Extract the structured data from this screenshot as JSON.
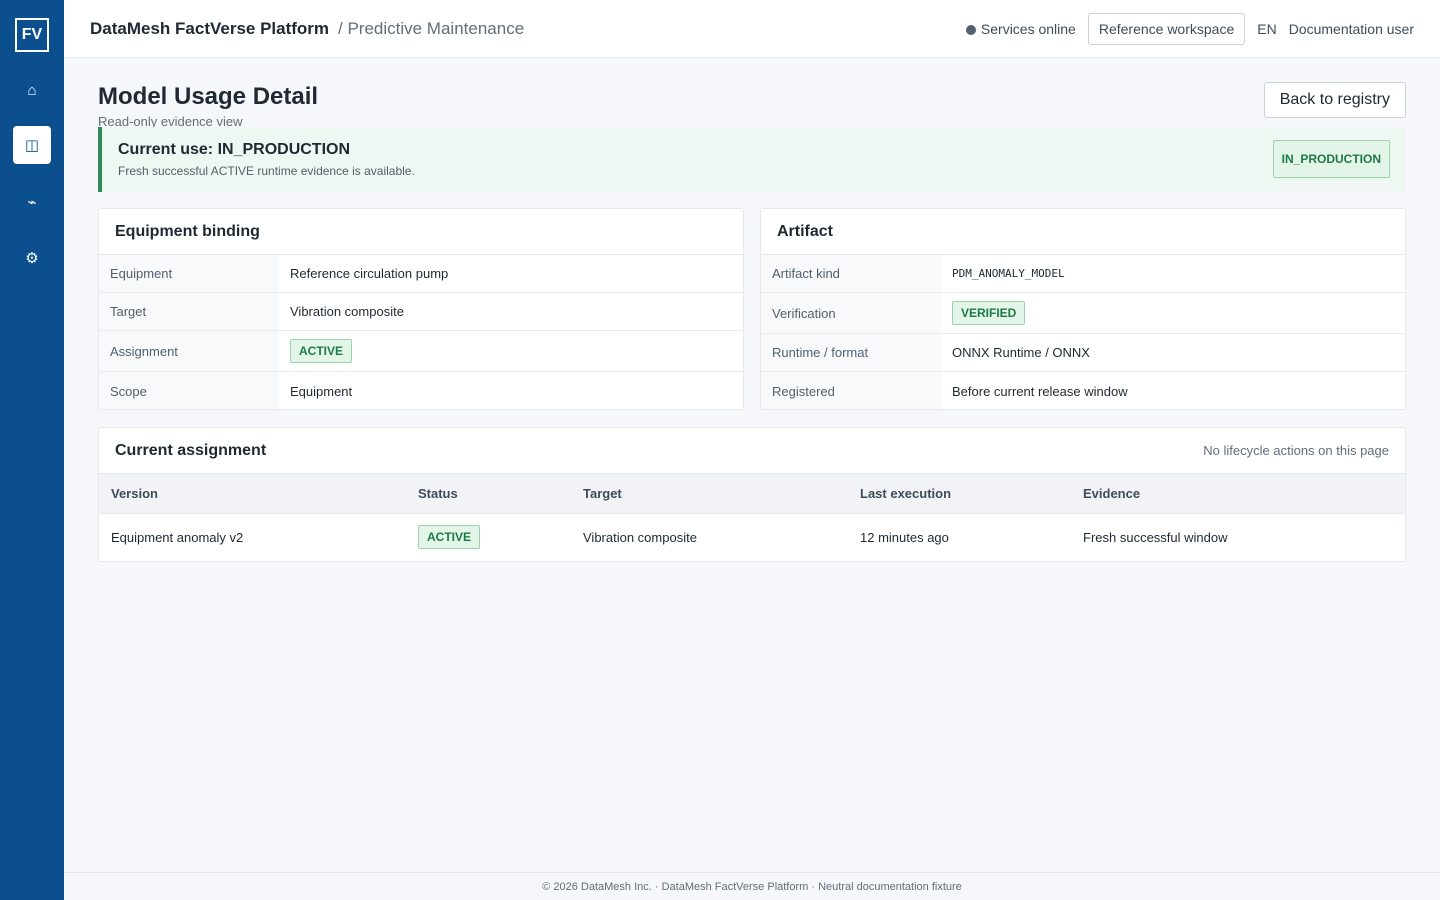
{
  "sidebar": {
    "logo": "FV",
    "items": [
      {
        "icon": "home-icon",
        "glyph": "⌂"
      },
      {
        "icon": "model-registry-icon",
        "glyph": "◫"
      },
      {
        "icon": "signal-icon",
        "glyph": "⌁"
      },
      {
        "icon": "gear-icon",
        "glyph": "⚙"
      }
    ],
    "active_index": 1
  },
  "header": {
    "brand": "DataMesh FactVerse Platform",
    "breadcrumb": "/ Predictive Maintenance",
    "status": "Services online",
    "workspace_button": "Reference workspace",
    "language": "EN",
    "user": "Documentation user"
  },
  "page": {
    "title": "Model Usage Detail",
    "subtitle": "Read-only evidence view",
    "back_button": "Back to registry"
  },
  "banner": {
    "title": "Current use: IN_PRODUCTION",
    "text": "Fresh successful ACTIVE runtime evidence is available.",
    "badge": "IN_PRODUCTION",
    "accent": "#2f8a5b"
  },
  "equipment_binding": {
    "title": "Equipment binding",
    "rows": [
      {
        "label": "Equipment",
        "value": "Reference circulation pump"
      },
      {
        "label": "Target",
        "value": "Vibration composite"
      },
      {
        "label": "Assignment",
        "value": "ACTIVE"
      },
      {
        "label": "Scope",
        "value": "Equipment"
      }
    ]
  },
  "artifact": {
    "title": "Artifact",
    "rows": [
      {
        "label": "Artifact kind",
        "value": "PDM_ANOMALY_MODEL"
      },
      {
        "label": "Verification",
        "value": "VERIFIED"
      },
      {
        "label": "Runtime / format",
        "value": "ONNX Runtime / ONNX"
      },
      {
        "label": "Registered",
        "value": "Before current release window"
      }
    ]
  },
  "assignment": {
    "title": "Current assignment",
    "note": "No lifecycle actions on this page",
    "columns": [
      "Version",
      "Status",
      "Target",
      "Last execution",
      "Evidence"
    ],
    "rows": [
      [
        "Equipment anomaly v2",
        "ACTIVE",
        "Vibration composite",
        "12 minutes ago",
        "Fresh successful window"
      ]
    ]
  },
  "footer": {
    "text": "© 2026 DataMesh Inc. · DataMesh FactVerse Platform · Neutral documentation fixture"
  },
  "colors": {
    "sidebar": "#0b4f8e",
    "success": "#1e7a47",
    "success_bg": "#e3f4e9"
  }
}
